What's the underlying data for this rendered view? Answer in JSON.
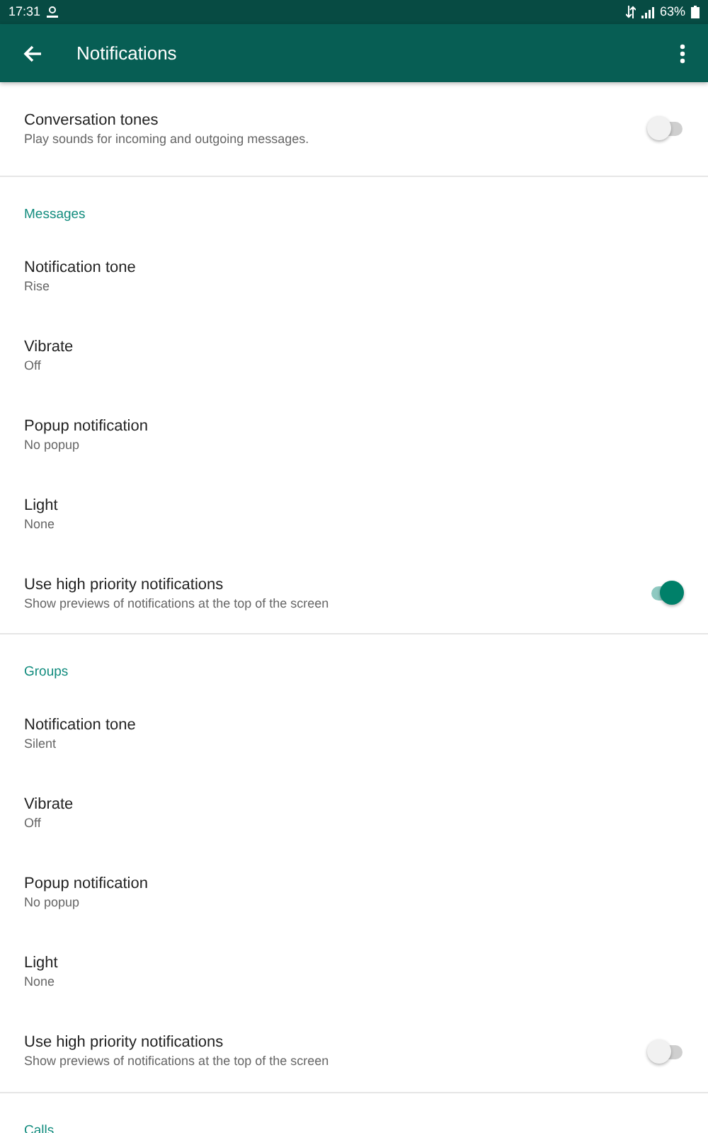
{
  "status_bar": {
    "time": "17:31",
    "battery": "63%"
  },
  "app_bar": {
    "title": "Notifications"
  },
  "sections": [
    {
      "items": [
        {
          "kind": "toggle",
          "title": "Conversation tones",
          "subtitle": "Play sounds for incoming and outgoing messages.",
          "on": false
        }
      ]
    },
    {
      "header": "Messages",
      "items": [
        {
          "kind": "value",
          "title": "Notification tone",
          "subtitle": "Rise"
        },
        {
          "kind": "value",
          "title": "Vibrate",
          "subtitle": "Off"
        },
        {
          "kind": "value",
          "title": "Popup notification",
          "subtitle": "No popup"
        },
        {
          "kind": "value",
          "title": "Light",
          "subtitle": "None"
        },
        {
          "kind": "toggle",
          "title": "Use high priority notifications",
          "subtitle": "Show previews of notifications at the top of the screen",
          "on": true
        }
      ]
    },
    {
      "header": "Groups",
      "items": [
        {
          "kind": "value",
          "title": "Notification tone",
          "subtitle": "Silent"
        },
        {
          "kind": "value",
          "title": "Vibrate",
          "subtitle": "Off"
        },
        {
          "kind": "value",
          "title": "Popup notification",
          "subtitle": "No popup"
        },
        {
          "kind": "value",
          "title": "Light",
          "subtitle": "None"
        },
        {
          "kind": "toggle",
          "title": "Use high priority notifications",
          "subtitle": "Show previews of notifications at the top of the screen",
          "on": false
        }
      ]
    },
    {
      "header": "Calls"
    }
  ]
}
